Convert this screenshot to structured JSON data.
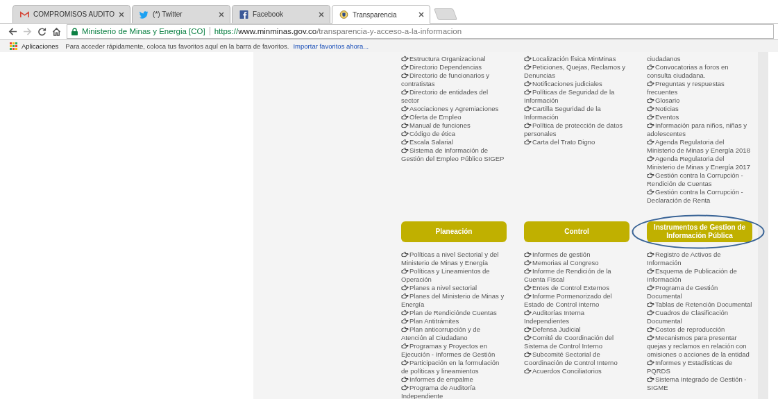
{
  "browser": {
    "tabs": [
      {
        "title": "COMPROMISOS AUDITO",
        "selected": false
      },
      {
        "title": "(*) Twitter",
        "selected": false
      },
      {
        "title": "Facebook",
        "selected": false
      },
      {
        "title": "Transparencia",
        "selected": true
      }
    ],
    "navigation": {
      "forward_enabled": false
    },
    "address_bar": {
      "site_name": "Ministerio de Minas y Energia [CO]",
      "scheme": "https://",
      "host": "www.minminas.gov.co",
      "path": "/transparencia-y-acceso-a-la-informacion"
    },
    "bookmarks_bar": {
      "apps": "Aplicaciones",
      "hint": "Para acceder rápidamente, coloca tus favoritos aquí en la barra de favoritos.",
      "import_link": "Importar favoritos ahora..."
    }
  },
  "top_lists": [
    [
      {
        "kind": "link",
        "text": "Estructura Organizacional"
      },
      {
        "kind": "link",
        "text": "Directorio Dependencias"
      },
      {
        "kind": "link",
        "text": "Directorio de funcionarios y contratistas"
      },
      {
        "kind": "link",
        "text": "Directorio de entidades del sector"
      },
      {
        "kind": "link",
        "text": "Asociaciones y Agremiaciones"
      },
      {
        "kind": "link",
        "text": "Oferta de Empleo"
      },
      {
        "kind": "link",
        "text": "Manual de funciones"
      },
      {
        "kind": "link",
        "text": "Código de ética"
      },
      {
        "kind": "link",
        "text": "Escala Salarial"
      },
      {
        "kind": "link",
        "text": "Sistema de Información de Gestión del Empleo Público SIGEP"
      }
    ],
    [
      {
        "kind": "link",
        "text": "Localización física MinMinas"
      },
      {
        "kind": "link",
        "text": "Peticiones, Quejas, Reclamos y Denuncias"
      },
      {
        "kind": "link",
        "text": "Notificaciones judiciales"
      },
      {
        "kind": "link",
        "text": "Políticas de Seguridad de la Información"
      },
      {
        "kind": "link",
        "text": "Cartilla Seguridad de la Información"
      },
      {
        "kind": "link",
        "text": "Política de protección de datos personales"
      },
      {
        "kind": "link",
        "text": "Carta del Trato Digno"
      }
    ],
    [
      {
        "kind": "continuation",
        "text": "ciudadanos"
      },
      {
        "kind": "link",
        "text": "Convocatorias a foros en consulta ciudadana."
      },
      {
        "kind": "link",
        "text": "Preguntas y respuestas frecuentes"
      },
      {
        "kind": "link",
        "text": "Glosario"
      },
      {
        "kind": "link",
        "text": "Noticias"
      },
      {
        "kind": "link",
        "text": "Eventos"
      },
      {
        "kind": "link",
        "text": "Información para niños, niñas y adolescentes"
      },
      {
        "kind": "link",
        "text": "Agenda Regulatoria del Ministerio de Minas y Energía 2018"
      },
      {
        "kind": "link",
        "text": "Agenda Regulatoria del Ministerio de Minas y Energía 2017"
      },
      {
        "kind": "link",
        "text": "Gestión contra la Corrupción - Rendición de Cuentas"
      },
      {
        "kind": "link",
        "text": "Gestión contra la Corrupción - Declaración de Renta"
      }
    ]
  ],
  "sections": [
    {
      "title": "Planeación",
      "circled": false,
      "items": [
        {
          "kind": "link",
          "text": "Políticas a nivel Sectorial y del Ministerio de Minas y Energía"
        },
        {
          "kind": "link",
          "text": "Políticas y Lineamientos de Operación"
        },
        {
          "kind": "link",
          "text": "Planes a nivel sectorial"
        },
        {
          "kind": "link",
          "text": "Planes del Ministerio de Minas y Energía"
        },
        {
          "kind": "link",
          "text": "Plan de Rendiciónde Cuentas"
        },
        {
          "kind": "link",
          "text": "Plan Antitrámites"
        },
        {
          "kind": "link",
          "text": "Plan anticorrupción y de Atención al Ciudadano"
        },
        {
          "kind": "link",
          "text": "Programas y Proyectos en Ejecución - Informes de Gestión"
        },
        {
          "kind": "link",
          "text": "Participación en la formulación de políticas y lineamientos"
        },
        {
          "kind": "link",
          "text": "Informes de empalme"
        },
        {
          "kind": "link",
          "text": "Programa de Auditoría Independiente"
        }
      ]
    },
    {
      "title": "Control",
      "circled": false,
      "items": [
        {
          "kind": "link",
          "text": "Informes de gestión"
        },
        {
          "kind": "link",
          "text": "Memorias al Congreso"
        },
        {
          "kind": "link",
          "text": "Informe de Rendición de la Cuenta Fiscal"
        },
        {
          "kind": "link",
          "text": "Entes de Control Externos"
        },
        {
          "kind": "link",
          "text": "Informe Pormenorizado del Estado de Control Interno"
        },
        {
          "kind": "link",
          "text": "Auditorías Interna Independientes"
        },
        {
          "kind": "link",
          "text": "Defensa Judicial"
        },
        {
          "kind": "link",
          "text": "Comité de Coordinación del Sistema de Control Interno"
        },
        {
          "kind": "link",
          "text": "Subcomité Sectorial de Coordinación de Control Interno"
        },
        {
          "kind": "link",
          "text": "Acuerdos Conciliatorios"
        }
      ]
    },
    {
      "title": "Instrumentos de Gestion de Información Pública",
      "circled": true,
      "items": [
        {
          "kind": "link",
          "text": "Registro de Activos de Información"
        },
        {
          "kind": "link",
          "text": "Esquema de Publicación de Información"
        },
        {
          "kind": "link",
          "text": "Programa de Gestión Documental"
        },
        {
          "kind": "link",
          "text": "Tablas de Retención Documental"
        },
        {
          "kind": "link",
          "text": "Cuadros de Clasificación Documental"
        },
        {
          "kind": "link",
          "text": "Costos de reproducción"
        },
        {
          "kind": "link",
          "text": "Mecanismos para presentar quejas y reclamos en relación con omisiones o acciones de la entidad"
        },
        {
          "kind": "link",
          "text": "Informes y Estadísticas de PQRDS"
        },
        {
          "kind": "link",
          "text": "Sistema Integrado de Gestión - SIGME"
        }
      ]
    }
  ]
}
